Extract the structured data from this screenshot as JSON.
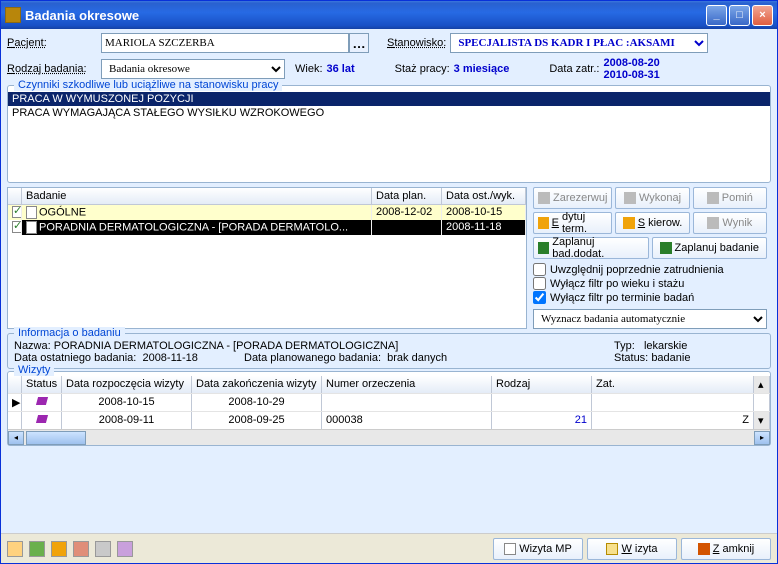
{
  "window": {
    "title": "Badania okresowe"
  },
  "header": {
    "patient_label": "Pacjent:",
    "patient_value": "MARIOLA SZCZERBA",
    "position_label": "Stanowisko:",
    "position_value": "SPECJALISTA DS KADR I PŁAC :AKSAMI",
    "exam_type_label": "Rodzaj badania:",
    "exam_type_value": "Badania okresowe",
    "age_label": "Wiek:",
    "age_value": "36 lat",
    "tenure_label": "Staż pracy:",
    "tenure_value": "3 miesiące",
    "emp_date_label": "Data zatr.:",
    "emp_date_value1": "2008-08-20",
    "emp_date_value2": "2010-08-31"
  },
  "factors": {
    "legend": "Czynniki szkodliwe lub uciążliwe na stanowisku pracy",
    "items": [
      "PRACA W WYMUSZONEJ POZYCJI",
      "PRACA WYMAGAJĄCA STAŁEGO WYSIŁKU WZROKOWEGO"
    ]
  },
  "exams": {
    "cols": {
      "c0": "",
      "c1": "Badanie",
      "c2": "Data plan.",
      "c3": "Data ost./wyk."
    },
    "rows": [
      {
        "name": "OGÓLNE",
        "plan": "2008-12-02",
        "last": "2008-10-15"
      },
      {
        "name": "PORADNIA DERMATOLOGICZNA - [PORADA DERMATOLO...",
        "plan": "",
        "last": "2008-11-18"
      }
    ]
  },
  "actions": {
    "reserve": "Zarezerwuj",
    "perform": "Wykonaj",
    "skip": "Pomiń",
    "edit_term": "Edytuj term.",
    "referral": "Skierow.",
    "result": "Wynik",
    "plan_extra": "Zaplanuj bad.dodat.",
    "plan_exam": "Zaplanuj badanie"
  },
  "checks": {
    "prev_emp": "Uwzględnij poprzednie zatrudnienia",
    "age_tenure": "Wyłącz filtr po wieku i stażu",
    "term": "Wyłącz filtr po terminie badań"
  },
  "auto_select": "Wyznacz badania automatycznie",
  "info": {
    "legend": "Informacja o badaniu",
    "name_label": "Nazwa:",
    "name_value": "PORADNIA DERMATOLOGICZNA - [PORADA DERMATOLOGICZNA]",
    "type_label": "Typ:",
    "type_value": "lekarskie",
    "last_label": "Data ostatniego badania:",
    "last_value": "2008-11-18",
    "plan_label": "Data planowanego badania:",
    "plan_value": "brak danych",
    "status_label": "Status:",
    "status_value": "badanie"
  },
  "visits": {
    "legend": "Wizyty",
    "cols": {
      "c0": "",
      "c1": "Status",
      "c2": "Data rozpoczęcia wizyty",
      "c3": "Data zakończenia wizyty",
      "c4": "Numer orzeczenia",
      "c5": "Rodzaj",
      "c6": "Zat."
    },
    "rows": [
      {
        "marker": "▶",
        "start": "2008-10-15",
        "end": "2008-10-29",
        "num": "",
        "type": "",
        "zat": ""
      },
      {
        "marker": "",
        "start": "2008-09-11",
        "end": "2008-09-25",
        "num": "000038",
        "type": "21",
        "zat": "Z"
      }
    ]
  },
  "bottom": {
    "visit_mp": "Wizyta MP",
    "visit": "Wizyta",
    "close": "Zamknij"
  }
}
